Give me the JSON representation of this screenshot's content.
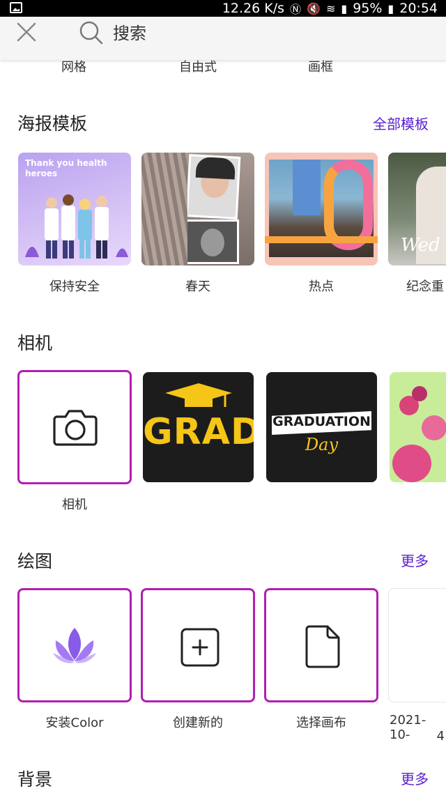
{
  "status_bar": {
    "speed": "12.26 K/s",
    "battery": "95%",
    "time": "20:54"
  },
  "search_bar": {
    "label": "搜索"
  },
  "categories": [
    "网格",
    "自由式",
    "画框"
  ],
  "poster_section": {
    "title": "海报模板",
    "link": "全部模板",
    "items": [
      {
        "label": "保持安全",
        "overlay_text": "Thank you health heroes"
      },
      {
        "label": "春天"
      },
      {
        "label": "热点"
      },
      {
        "label": "纪念重",
        "overlay_text": "Wed"
      }
    ]
  },
  "camera_section": {
    "title": "相机",
    "items": [
      {
        "label": "相机"
      },
      {
        "label": "",
        "overlay_text": "GRAD"
      },
      {
        "label": "",
        "overlay_text": "GRADUATION",
        "overlay_sub": "Day"
      },
      {
        "label": ""
      }
    ]
  },
  "drawing_section": {
    "title": "绘图",
    "link": "更多",
    "items": [
      {
        "label": "安装Color"
      },
      {
        "label": "创建新的"
      },
      {
        "label": "选择画布"
      },
      {
        "label": "2021-10-",
        "label2": "4"
      }
    ]
  },
  "background_section": {
    "title": "背景",
    "link": "更多"
  },
  "colors": {
    "accent": "#5a1fd1",
    "frame": "#b01fb2"
  }
}
